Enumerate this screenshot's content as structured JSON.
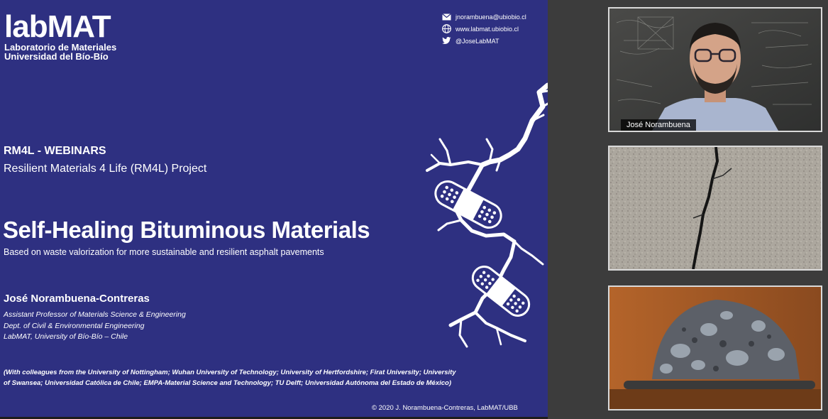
{
  "logo": {
    "wordmark": "labMAT",
    "line1": "Laboratorio de Materiales",
    "line2": "Universidad del Bío-Bío"
  },
  "contact": {
    "email": "jnorambuena@ubiobio.cl",
    "web": "www.labmat.ubiobio.cl",
    "twitter": "@JoseLabMAT"
  },
  "slide": {
    "series": "RM4L - WEBINARS",
    "project": "Resilient Materials 4 Life (RM4L) Project",
    "title": "Self-Healing Bituminous Materials",
    "subtitle": "Based on waste valorization for more sustainable and resilient asphalt pavements",
    "author": "José Norambuena-Contreras",
    "affiliations": [
      "Assistant Professor of Materials Science & Engineering",
      "Dept. of Civil & Environmental Engineering",
      "LabMAT, University of Bío-Bío – Chile"
    ],
    "colleagues_line1": "(With colleagues from the University of Nottingham; Wuhan University of Technology; University of Hertfordshire; Firat University; University",
    "colleagues_line2": "of Swansea; Universidad Católica de Chile; EMPA-Material Science and Technology; TU Delft; Universidad Autónoma del Estado de México)",
    "copyright": "© 2020  J. Norambuena-Contreras, LabMAT/UBB"
  },
  "participants": {
    "speaker_name": "José Norambuena"
  },
  "colors": {
    "slide_bg": "#2e3081",
    "sidebar_bg": "#3c3c3c"
  }
}
